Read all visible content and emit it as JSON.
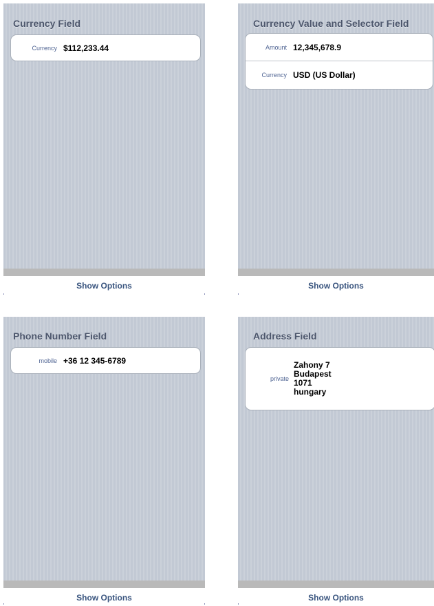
{
  "screens": [
    {
      "title": "Currency Field",
      "rows": [
        {
          "label": "Currency",
          "value": "$112,233.44"
        }
      ],
      "footer_button": "Show Options"
    },
    {
      "title": "Currency Value and Selector Field",
      "rows": [
        {
          "label": "Amount",
          "value": "12,345,678.9"
        },
        {
          "label": "Currency",
          "value": "USD (US Dollar)"
        }
      ],
      "footer_button": "Show Options"
    },
    {
      "title": "Phone Number Field",
      "rows": [
        {
          "label": "mobile",
          "value": "+36 12 345-6789"
        }
      ],
      "footer_button": "Show Options"
    },
    {
      "title": "Address Field",
      "rows": [
        {
          "label": "private",
          "lines": [
            "Zahony 7",
            "Budapest",
            "1071",
            "hungary"
          ]
        }
      ],
      "footer_button": "Show Options"
    }
  ],
  "colors": {
    "background_stripes": "#c5ccd6",
    "title_text": "#4c566c",
    "label_text": "#4e6392",
    "value_text": "#000000",
    "footer_button_text": "#3a557f",
    "bottom_bar": "#b9b9b9"
  }
}
